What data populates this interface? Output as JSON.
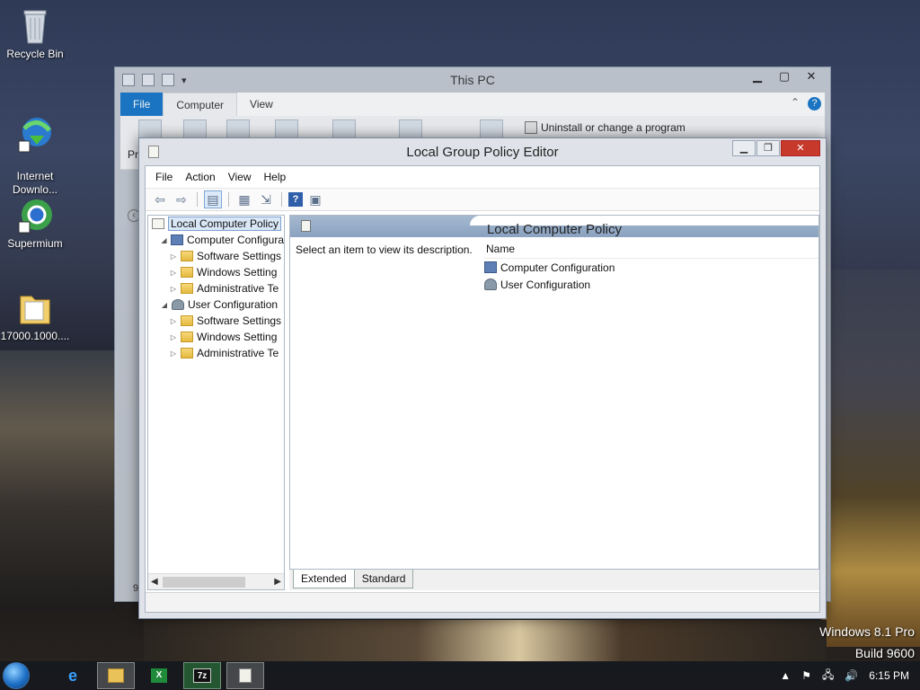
{
  "desktop": {
    "icons": [
      {
        "label": "Recycle Bin"
      },
      {
        "label": "Internet\nDownlo..."
      },
      {
        "label": "Supermium"
      },
      {
        "label": "17000.1000...."
      }
    ],
    "os_line1": "Windows 8.1 Pro",
    "os_line2": "Build 9600"
  },
  "thispc": {
    "title": "This PC",
    "tabs": [
      "File",
      "Computer",
      "View"
    ],
    "ribbon_uninstall": "Uninstall or change a program",
    "ribbon_partial": "Pr",
    "left_partial": "9"
  },
  "gpe": {
    "title": "Local Group Policy Editor",
    "menu": [
      "File",
      "Action",
      "View",
      "Help"
    ],
    "tree": [
      {
        "label": "Local Computer Policy",
        "level": 0,
        "icon": "policy",
        "arrow": ""
      },
      {
        "label": "Computer Configura",
        "level": 1,
        "icon": "comp",
        "arrow": "◢"
      },
      {
        "label": "Software Settings",
        "level": 2,
        "icon": "folder",
        "arrow": "▷"
      },
      {
        "label": "Windows Setting",
        "level": 2,
        "icon": "folder",
        "arrow": "▷"
      },
      {
        "label": "Administrative Te",
        "level": 2,
        "icon": "folder",
        "arrow": "▷"
      },
      {
        "label": "User Configuration",
        "level": 1,
        "icon": "user",
        "arrow": "◢"
      },
      {
        "label": "Software Settings",
        "level": 2,
        "icon": "folder",
        "arrow": "▷"
      },
      {
        "label": "Windows Setting",
        "level": 2,
        "icon": "folder",
        "arrow": "▷"
      },
      {
        "label": "Administrative Te",
        "level": 2,
        "icon": "folder",
        "arrow": "▷"
      }
    ],
    "details": {
      "header": "Local Computer Policy",
      "description": "Select an item to view its description.",
      "column_name": "Name",
      "items": [
        {
          "label": "Computer Configuration",
          "icon": "comp"
        },
        {
          "label": "User Configuration",
          "icon": "user"
        }
      ]
    },
    "bottom_tabs": [
      "Extended",
      "Standard"
    ]
  },
  "taskbar": {
    "time": "6:15 PM",
    "apps": [
      "ie",
      "explorer",
      "excel",
      "7z",
      "gpedit"
    ]
  },
  "colors": {
    "accent": "#1979ca",
    "close": "#c7392b",
    "header": "#8aa2c0"
  }
}
